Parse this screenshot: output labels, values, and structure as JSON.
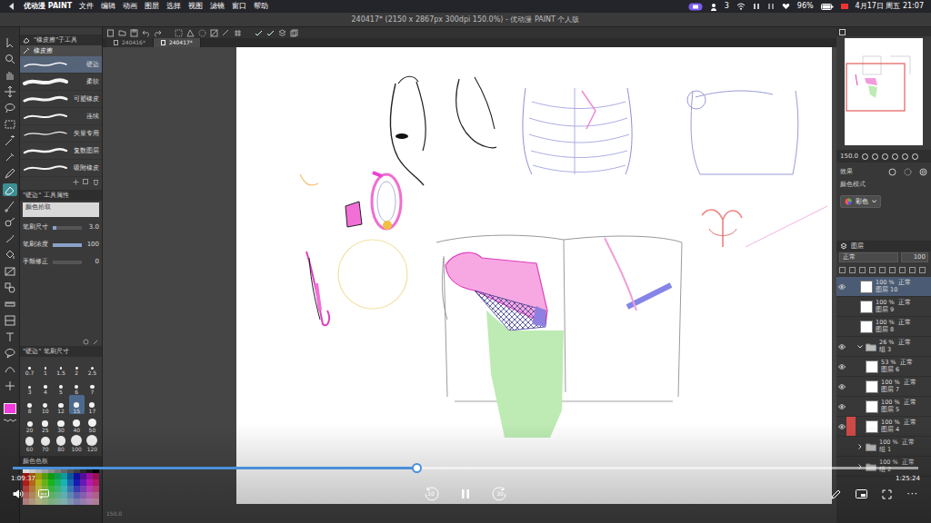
{
  "menubar": {
    "app": "优动漫 PAINT",
    "menus": [
      "文件",
      "编辑",
      "动画",
      "图层",
      "选择",
      "视图",
      "滤镜",
      "窗口",
      "帮助"
    ],
    "status": {
      "count": "3",
      "battery": "96%",
      "datetime": "4月17日 周五 21:07"
    }
  },
  "window": {
    "title": "240417* (2150 x 2867px 300dpi 150.0%) - 优动漫 PAINT 个人版"
  },
  "doc_tabs": [
    {
      "label": "240416*",
      "selected": false
    },
    {
      "label": "240417*",
      "selected": true
    }
  ],
  "tools": [
    {
      "selected": false
    },
    {
      "selected": false
    },
    {
      "selected": false
    },
    {
      "selected": false
    },
    {
      "selected": false
    },
    {
      "selected": false
    },
    {
      "selected": false
    },
    {
      "selected": false
    },
    {
      "selected": false
    },
    {
      "selected": true
    },
    {
      "selected": false
    },
    {
      "selected": false
    },
    {
      "selected": false
    },
    {
      "selected": false
    },
    {
      "selected": false
    },
    {
      "selected": false
    },
    {
      "selected": false
    },
    {
      "selected": false
    },
    {
      "selected": false
    },
    {
      "selected": false
    },
    {
      "selected": false
    },
    {
      "selected": false
    }
  ],
  "main_color": "#f23bdc",
  "subtool": {
    "title": "\"橡皮擦\"子工具",
    "group": "橡皮擦",
    "items": [
      {
        "label": "硬边",
        "selected": true
      },
      {
        "label": "柔软",
        "selected": false
      },
      {
        "label": "可塑橡皮",
        "selected": false
      },
      {
        "label": "连续",
        "selected": false
      },
      {
        "label": "矢量专用",
        "selected": false
      },
      {
        "label": "复数图层",
        "selected": false
      },
      {
        "label": "吸附橡皮",
        "selected": false
      }
    ]
  },
  "tool_property": {
    "title": "\"硬边\" 工具属性",
    "preset": "颜色拾取",
    "rows": [
      {
        "label": "笔刷尺寸",
        "value": "3.0",
        "level": 0.12
      },
      {
        "label": "笔刷浓度",
        "value": "100",
        "level": 1
      },
      {
        "label": "手颤修正",
        "value": "0",
        "level": 0
      }
    ]
  },
  "brush_size": {
    "title": "\"硬边\" 笔刷尺寸",
    "sizes": [
      {
        "label": "0.7",
        "selected": false
      },
      {
        "label": "1",
        "selected": false
      },
      {
        "label": "1.5",
        "selected": false
      },
      {
        "label": "2",
        "selected": false
      },
      {
        "label": "2.5",
        "selected": false
      },
      {
        "label": "3",
        "selected": false
      },
      {
        "label": "4",
        "selected": false
      },
      {
        "label": "5",
        "selected": false
      },
      {
        "label": "6",
        "selected": false
      },
      {
        "label": "7",
        "selected": false
      },
      {
        "label": "8",
        "selected": false
      },
      {
        "label": "10",
        "selected": false
      },
      {
        "label": "12",
        "selected": false
      },
      {
        "label": "15",
        "selected": true
      },
      {
        "label": "17",
        "selected": false
      },
      {
        "label": "20",
        "selected": false
      },
      {
        "label": "25",
        "selected": false
      },
      {
        "label": "30",
        "selected": false
      },
      {
        "label": "40",
        "selected": false
      },
      {
        "label": "50",
        "selected": false
      },
      {
        "label": "60",
        "selected": false
      },
      {
        "label": "70",
        "selected": false
      },
      {
        "label": "80",
        "selected": false
      },
      {
        "label": "100",
        "selected": false
      },
      {
        "label": "120",
        "selected": false
      }
    ]
  },
  "palette": {
    "title": "颜色色板"
  },
  "canvas": {
    "zoom": "150.0"
  },
  "navigator": {
    "zoom": "150.0"
  },
  "layer_property": {
    "effect": "效果",
    "color_mode_label": "颜色模式",
    "color_mode": "彩色"
  },
  "layers": {
    "title": "图层",
    "blend": "正常",
    "opacity": "100",
    "items": [
      {
        "kind": "layer",
        "opacity": "100 %",
        "mode": "正常",
        "name": "图层 10",
        "selected": true,
        "visible": true,
        "tagged": false
      },
      {
        "kind": "layer",
        "opacity": "100 %",
        "mode": "正常",
        "name": "图层 9",
        "selected": false,
        "visible": false,
        "tagged": false
      },
      {
        "kind": "layer",
        "opacity": "100 %",
        "mode": "正常",
        "name": "图层 8",
        "selected": false,
        "visible": false,
        "tagged": false
      },
      {
        "kind": "folder",
        "opacity": "26 %",
        "mode": "正常",
        "name": "组 3",
        "selected": false,
        "visible": true,
        "tagged": false,
        "expanded": true,
        "children": [
          {
            "kind": "layer",
            "opacity": "53 %",
            "mode": "正常",
            "name": "图层 6",
            "selected": false,
            "visible": true,
            "tagged": false
          },
          {
            "kind": "layer",
            "opacity": "100 %",
            "mode": "正常",
            "name": "图层 7",
            "selected": false,
            "visible": true,
            "tagged": false
          },
          {
            "kind": "layer",
            "opacity": "100 %",
            "mode": "正常",
            "name": "图层 5",
            "selected": false,
            "visible": true,
            "tagged": false
          },
          {
            "kind": "layer",
            "opacity": "100 %",
            "mode": "正常",
            "name": "图层 4",
            "selected": false,
            "visible": true,
            "tagged": true
          }
        ]
      },
      {
        "kind": "folder",
        "opacity": "100 %",
        "mode": "正常",
        "name": "组 1",
        "selected": false,
        "visible": false,
        "tagged": false,
        "expanded": false,
        "children": []
      },
      {
        "kind": "folder",
        "opacity": "100 %",
        "mode": "正常",
        "name": "组 2",
        "selected": false,
        "visible": false,
        "tagged": false,
        "expanded": false,
        "children": []
      }
    ]
  },
  "video": {
    "elapsed": "1:09:37",
    "total": "1:25:24",
    "progress": 0.447,
    "playing": true,
    "rewind": "10",
    "forward": "30",
    "more": "···"
  }
}
